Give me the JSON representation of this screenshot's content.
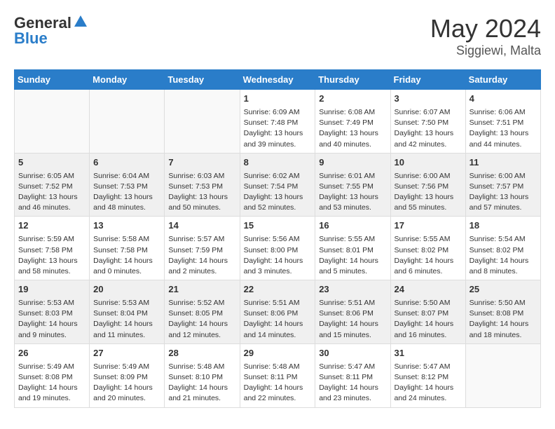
{
  "header": {
    "logo_general": "General",
    "logo_blue": "Blue",
    "month": "May 2024",
    "location": "Siggiewi, Malta"
  },
  "weekdays": [
    "Sunday",
    "Monday",
    "Tuesday",
    "Wednesday",
    "Thursday",
    "Friday",
    "Saturday"
  ],
  "weeks": [
    [
      {
        "day": "",
        "info": ""
      },
      {
        "day": "",
        "info": ""
      },
      {
        "day": "",
        "info": ""
      },
      {
        "day": "1",
        "info": "Sunrise: 6:09 AM\nSunset: 7:48 PM\nDaylight: 13 hours\nand 39 minutes."
      },
      {
        "day": "2",
        "info": "Sunrise: 6:08 AM\nSunset: 7:49 PM\nDaylight: 13 hours\nand 40 minutes."
      },
      {
        "day": "3",
        "info": "Sunrise: 6:07 AM\nSunset: 7:50 PM\nDaylight: 13 hours\nand 42 minutes."
      },
      {
        "day": "4",
        "info": "Sunrise: 6:06 AM\nSunset: 7:51 PM\nDaylight: 13 hours\nand 44 minutes."
      }
    ],
    [
      {
        "day": "5",
        "info": "Sunrise: 6:05 AM\nSunset: 7:52 PM\nDaylight: 13 hours\nand 46 minutes."
      },
      {
        "day": "6",
        "info": "Sunrise: 6:04 AM\nSunset: 7:53 PM\nDaylight: 13 hours\nand 48 minutes."
      },
      {
        "day": "7",
        "info": "Sunrise: 6:03 AM\nSunset: 7:53 PM\nDaylight: 13 hours\nand 50 minutes."
      },
      {
        "day": "8",
        "info": "Sunrise: 6:02 AM\nSunset: 7:54 PM\nDaylight: 13 hours\nand 52 minutes."
      },
      {
        "day": "9",
        "info": "Sunrise: 6:01 AM\nSunset: 7:55 PM\nDaylight: 13 hours\nand 53 minutes."
      },
      {
        "day": "10",
        "info": "Sunrise: 6:00 AM\nSunset: 7:56 PM\nDaylight: 13 hours\nand 55 minutes."
      },
      {
        "day": "11",
        "info": "Sunrise: 6:00 AM\nSunset: 7:57 PM\nDaylight: 13 hours\nand 57 minutes."
      }
    ],
    [
      {
        "day": "12",
        "info": "Sunrise: 5:59 AM\nSunset: 7:58 PM\nDaylight: 13 hours\nand 58 minutes."
      },
      {
        "day": "13",
        "info": "Sunrise: 5:58 AM\nSunset: 7:58 PM\nDaylight: 14 hours\nand 0 minutes."
      },
      {
        "day": "14",
        "info": "Sunrise: 5:57 AM\nSunset: 7:59 PM\nDaylight: 14 hours\nand 2 minutes."
      },
      {
        "day": "15",
        "info": "Sunrise: 5:56 AM\nSunset: 8:00 PM\nDaylight: 14 hours\nand 3 minutes."
      },
      {
        "day": "16",
        "info": "Sunrise: 5:55 AM\nSunset: 8:01 PM\nDaylight: 14 hours\nand 5 minutes."
      },
      {
        "day": "17",
        "info": "Sunrise: 5:55 AM\nSunset: 8:02 PM\nDaylight: 14 hours\nand 6 minutes."
      },
      {
        "day": "18",
        "info": "Sunrise: 5:54 AM\nSunset: 8:02 PM\nDaylight: 14 hours\nand 8 minutes."
      }
    ],
    [
      {
        "day": "19",
        "info": "Sunrise: 5:53 AM\nSunset: 8:03 PM\nDaylight: 14 hours\nand 9 minutes."
      },
      {
        "day": "20",
        "info": "Sunrise: 5:53 AM\nSunset: 8:04 PM\nDaylight: 14 hours\nand 11 minutes."
      },
      {
        "day": "21",
        "info": "Sunrise: 5:52 AM\nSunset: 8:05 PM\nDaylight: 14 hours\nand 12 minutes."
      },
      {
        "day": "22",
        "info": "Sunrise: 5:51 AM\nSunset: 8:06 PM\nDaylight: 14 hours\nand 14 minutes."
      },
      {
        "day": "23",
        "info": "Sunrise: 5:51 AM\nSunset: 8:06 PM\nDaylight: 14 hours\nand 15 minutes."
      },
      {
        "day": "24",
        "info": "Sunrise: 5:50 AM\nSunset: 8:07 PM\nDaylight: 14 hours\nand 16 minutes."
      },
      {
        "day": "25",
        "info": "Sunrise: 5:50 AM\nSunset: 8:08 PM\nDaylight: 14 hours\nand 18 minutes."
      }
    ],
    [
      {
        "day": "26",
        "info": "Sunrise: 5:49 AM\nSunset: 8:08 PM\nDaylight: 14 hours\nand 19 minutes."
      },
      {
        "day": "27",
        "info": "Sunrise: 5:49 AM\nSunset: 8:09 PM\nDaylight: 14 hours\nand 20 minutes."
      },
      {
        "day": "28",
        "info": "Sunrise: 5:48 AM\nSunset: 8:10 PM\nDaylight: 14 hours\nand 21 minutes."
      },
      {
        "day": "29",
        "info": "Sunrise: 5:48 AM\nSunset: 8:11 PM\nDaylight: 14 hours\nand 22 minutes."
      },
      {
        "day": "30",
        "info": "Sunrise: 5:47 AM\nSunset: 8:11 PM\nDaylight: 14 hours\nand 23 minutes."
      },
      {
        "day": "31",
        "info": "Sunrise: 5:47 AM\nSunset: 8:12 PM\nDaylight: 14 hours\nand 24 minutes."
      },
      {
        "day": "",
        "info": ""
      }
    ]
  ]
}
